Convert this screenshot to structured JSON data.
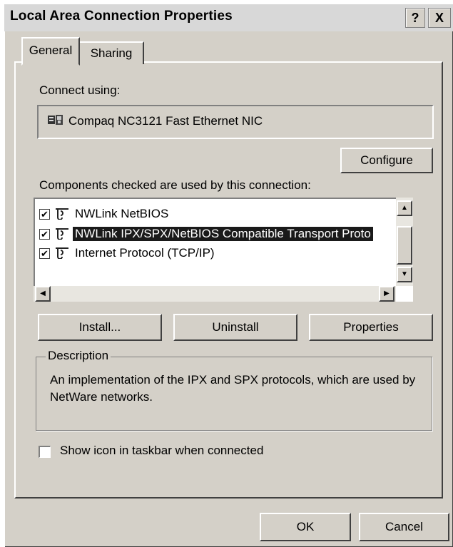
{
  "window": {
    "title": "Local Area Connection Properties",
    "help_button": "?",
    "close_button": "X"
  },
  "tabs": [
    {
      "label": "General",
      "active": true
    },
    {
      "label": "Sharing",
      "active": false
    }
  ],
  "connect_using": {
    "label": "Connect using:",
    "adapter_name": "Compaq NC3121 Fast Ethernet NIC",
    "adapter_icon": "network-card-icon",
    "configure_button": "Configure"
  },
  "components": {
    "label": "Components checked are used by this connection:",
    "items": [
      {
        "name": "NWLink NetBIOS",
        "checked": true,
        "selected": false,
        "icon": "protocol-icon"
      },
      {
        "name": "NWLink IPX/SPX/NetBIOS Compatible Transport Proto",
        "checked": true,
        "selected": true,
        "icon": "protocol-icon"
      },
      {
        "name": "Internet Protocol (TCP/IP)",
        "checked": true,
        "selected": false,
        "icon": "protocol-icon"
      }
    ]
  },
  "buttons": {
    "install": "Install...",
    "uninstall": "Uninstall",
    "properties": "Properties",
    "ok": "OK",
    "cancel": "Cancel"
  },
  "description": {
    "title": "Description",
    "text": "An implementation of the IPX and SPX protocols, which are used by NetWare networks."
  },
  "show_icon": {
    "label": "Show icon in taskbar when connected",
    "checked": false
  }
}
